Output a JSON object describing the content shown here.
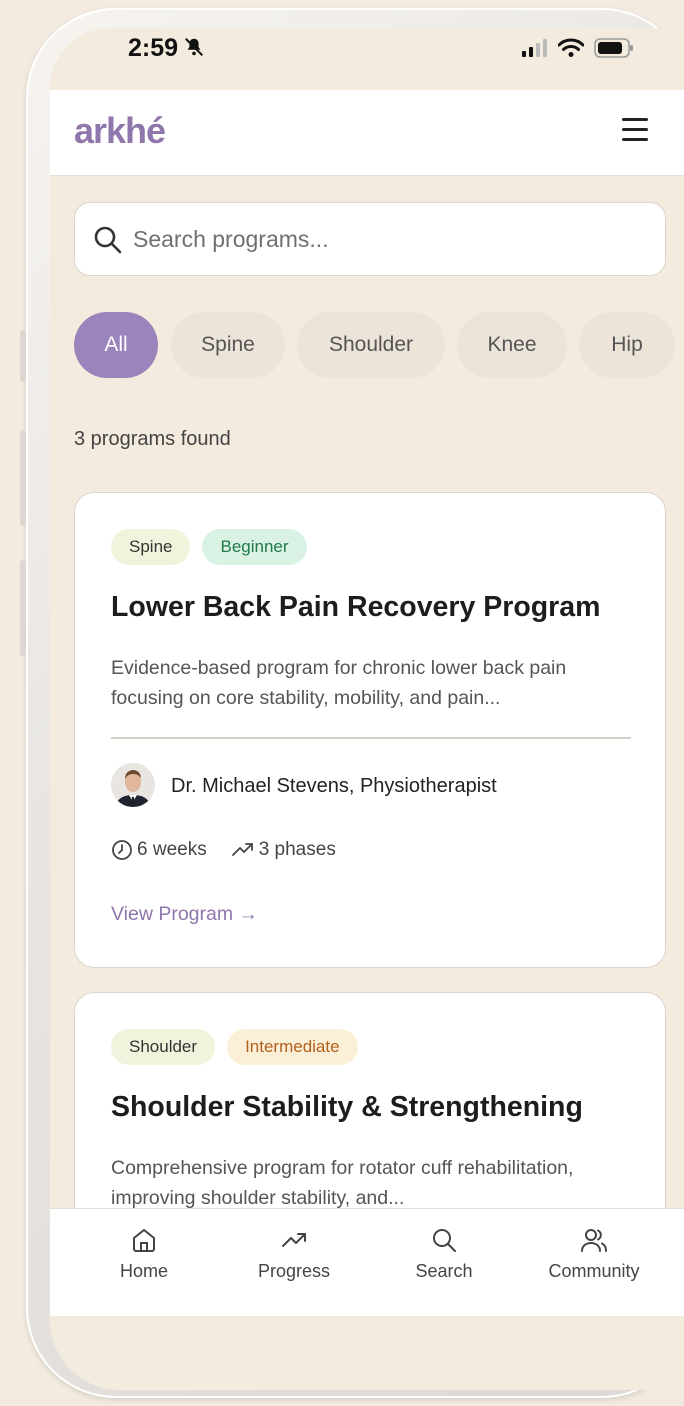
{
  "status_bar": {
    "time": "2:59"
  },
  "app": {
    "logo": "arkhé"
  },
  "search": {
    "placeholder": "Search programs..."
  },
  "filters": [
    {
      "label": "All",
      "active": true
    },
    {
      "label": "Spine",
      "active": false
    },
    {
      "label": "Shoulder",
      "active": false
    },
    {
      "label": "Knee",
      "active": false
    },
    {
      "label": "Hip",
      "active": false
    }
  ],
  "results": {
    "count_text": "3 programs found"
  },
  "programs": [
    {
      "category": "Spine",
      "level": "Beginner",
      "title": "Lower Back Pain Recovery Program",
      "description": "Evidence-based program for chronic lower back pain focusing on core stability, mobility, and pain...",
      "author": "Dr. Michael Stevens, Physiotherapist",
      "duration": "6 weeks",
      "phases": "3 phases",
      "link": "View Program →"
    },
    {
      "category": "Shoulder",
      "level": "Intermediate",
      "title": "Shoulder Stability & Strengthening",
      "description": "Comprehensive program for rotator cuff rehabilitation, improving shoulder stability, and..."
    }
  ],
  "tabbar": [
    {
      "label": "Home",
      "icon": "home-icon"
    },
    {
      "label": "Progress",
      "icon": "trending-icon"
    },
    {
      "label": "Search",
      "icon": "search-icon"
    },
    {
      "label": "Community",
      "icon": "users-icon"
    }
  ],
  "colors": {
    "accent": "#9b83bb",
    "logo": "#8f76ab",
    "background": "#f4ebdf"
  }
}
